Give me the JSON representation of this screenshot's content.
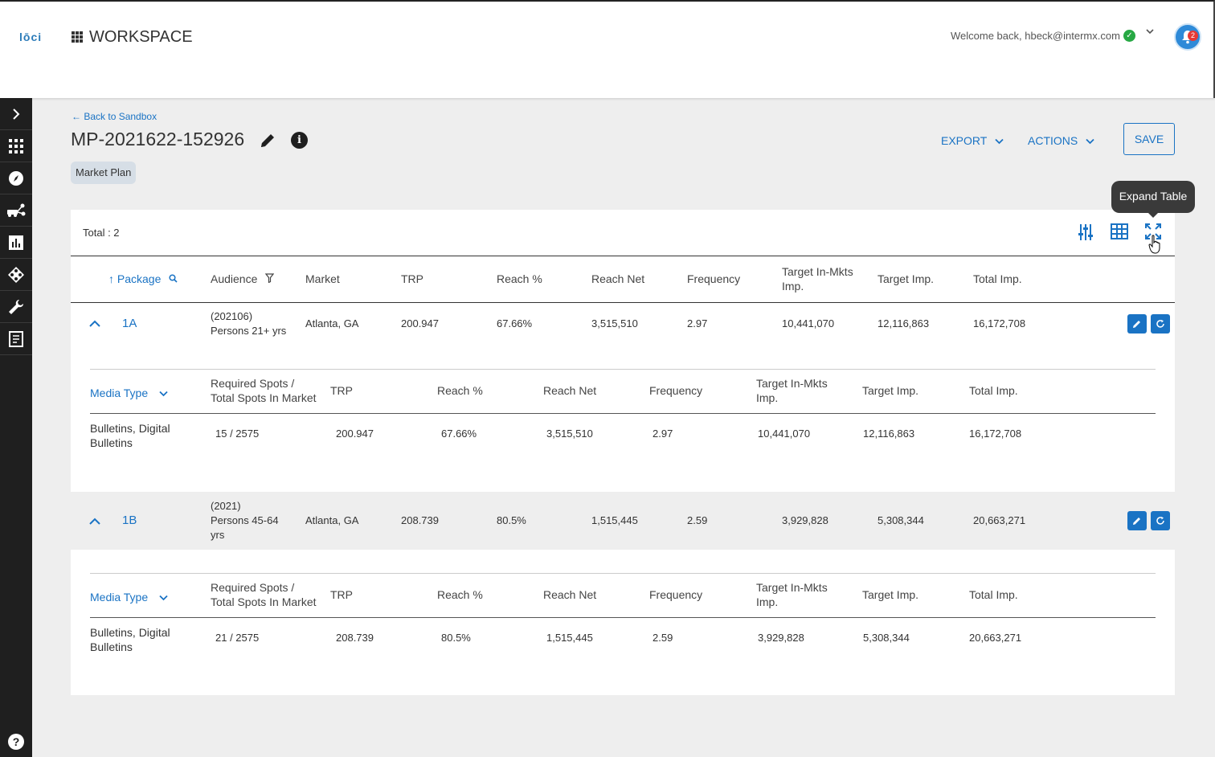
{
  "header": {
    "logo": "lōci",
    "workspace": "WORKSPACE",
    "welcome": "Welcome back, hbeck@intermx.com",
    "notifications": "2"
  },
  "sidebar": {
    "icons": [
      "chevron-right-icon",
      "grid-icon",
      "compass-icon",
      "vehicles-icon",
      "bar-chart-icon",
      "network-icon",
      "wrench-icon",
      "report-icon",
      "help-icon"
    ],
    "help": "?"
  },
  "page": {
    "back": "Back to Sandbox",
    "title": "MP-2021622-152926",
    "chip": "Market Plan",
    "export": "EXPORT",
    "actions": "ACTIONS",
    "save": "SAVE",
    "tooltip": "Expand Table"
  },
  "table": {
    "total": "Total : 2",
    "columns": {
      "package": "Package",
      "audience": "Audience",
      "market": "Market",
      "trp": "TRP",
      "reach_pct": "Reach %",
      "reach_net": "Reach Net",
      "frequency": "Frequency",
      "target_in_mkts_1": "Target In-Mkts",
      "target_in_mkts_2": "Imp.",
      "target_imp": "Target Imp.",
      "total_imp": "Total Imp."
    },
    "sub_columns": {
      "media_type": "Media Type",
      "spots_1": "Required Spots /",
      "spots_2": "Total Spots In Market",
      "trp": "TRP",
      "reach_pct": "Reach %",
      "reach_net": "Reach Net",
      "frequency": "Frequency",
      "target_in_mkts_1": "Target In-Mkts",
      "target_in_mkts_2": "Imp.",
      "target_imp": "Target Imp.",
      "total_imp": "Total Imp."
    },
    "rows": [
      {
        "package": "1A",
        "audience_1": "(202106)",
        "audience_2": "Persons 21+ yrs",
        "audience_3": "",
        "market": "Atlanta, GA",
        "trp": "200.947",
        "reach_pct": "67.66%",
        "reach_net": "3,515,510",
        "frequency": "2.97",
        "target_in_mkts": "10,441,070",
        "target_imp": "12,116,863",
        "total_imp": "16,172,708",
        "sub": {
          "media_1": "Bulletins, Digital",
          "media_2": "Bulletins",
          "spots": "15 / 2575",
          "trp": "200.947",
          "reach_pct": "67.66%",
          "reach_net": "3,515,510",
          "frequency": "2.97",
          "target_in_mkts": "10,441,070",
          "target_imp": "12,116,863",
          "total_imp": "16,172,708"
        }
      },
      {
        "package": "1B",
        "audience_1": "(2021)",
        "audience_2": "Persons 45-64",
        "audience_3": "yrs",
        "market": "Atlanta, GA",
        "trp": "208.739",
        "reach_pct": "80.5%",
        "reach_net": "1,515,445",
        "frequency": "2.59",
        "target_in_mkts": "3,929,828",
        "target_imp": "5,308,344",
        "total_imp": "20,663,271",
        "sub": {
          "media_1": "Bulletins, Digital",
          "media_2": "Bulletins",
          "spots": "21 / 2575",
          "trp": "208.739",
          "reach_pct": "80.5%",
          "reach_net": "1,515,445",
          "frequency": "2.59",
          "target_in_mkts": "3,929,828",
          "target_imp": "5,308,344",
          "total_imp": "20,663,271"
        }
      }
    ]
  },
  "colors": {
    "accent": "#1a73c4",
    "sidebar": "#1f1f1f",
    "success": "#27a844",
    "badge": "#e53935"
  }
}
